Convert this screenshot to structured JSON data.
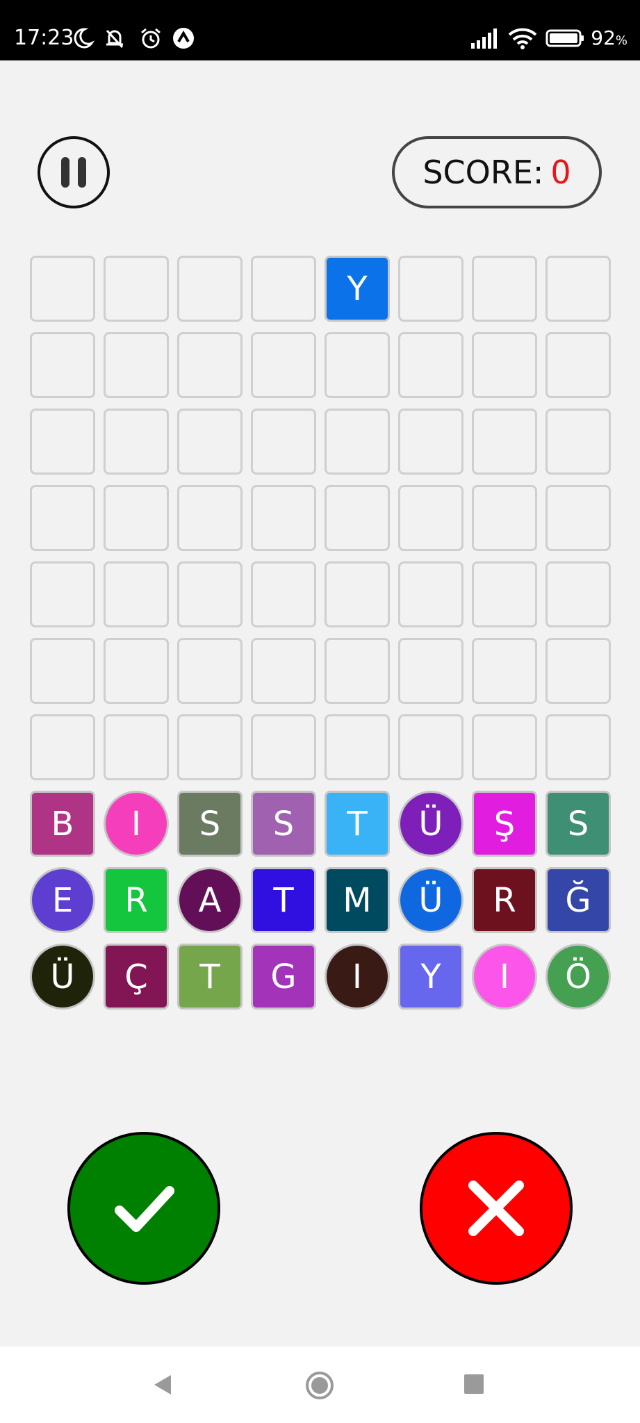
{
  "status_bar": {
    "time": "17:23",
    "battery": "92",
    "battery_unit": "%",
    "icons": [
      "moon-icon",
      "mute-icon",
      "alarm-icon",
      "app-notification-icon",
      "signal-icon",
      "wifi-icon",
      "battery-icon"
    ]
  },
  "header": {
    "pause_icon": "pause-icon",
    "score_label": "SCORE:",
    "score_value": "0",
    "score_color": "#e8161b"
  },
  "board": {
    "columns": 8,
    "rows": 10,
    "cells": [
      [
        null,
        null,
        null,
        null,
        {
          "letter": "Y",
          "color": "#0b72e9",
          "shape": "square"
        },
        null,
        null,
        null
      ],
      [
        null,
        null,
        null,
        null,
        null,
        null,
        null,
        null
      ],
      [
        null,
        null,
        null,
        null,
        null,
        null,
        null,
        null
      ],
      [
        null,
        null,
        null,
        null,
        null,
        null,
        null,
        null
      ],
      [
        null,
        null,
        null,
        null,
        null,
        null,
        null,
        null
      ],
      [
        null,
        null,
        null,
        null,
        null,
        null,
        null,
        null
      ],
      [
        null,
        null,
        null,
        null,
        null,
        null,
        null,
        null
      ],
      [
        {
          "letter": "B",
          "color": "#b03486",
          "shape": "square"
        },
        {
          "letter": "I",
          "color": "#f53ebc",
          "shape": "circle"
        },
        {
          "letter": "S",
          "color": "#6a7b62",
          "shape": "square"
        },
        {
          "letter": "S",
          "color": "#a061b0",
          "shape": "square"
        },
        {
          "letter": "T",
          "color": "#39b3f6",
          "shape": "square"
        },
        {
          "letter": "Ü",
          "color": "#7f1fb9",
          "shape": "circle"
        },
        {
          "letter": "Ş",
          "color": "#e11ee0",
          "shape": "square"
        },
        {
          "letter": "S",
          "color": "#3f8f74",
          "shape": "square"
        }
      ],
      [
        {
          "letter": "E",
          "color": "#5e3ed0",
          "shape": "circle"
        },
        {
          "letter": "R",
          "color": "#13c63d",
          "shape": "square"
        },
        {
          "letter": "A",
          "color": "#630f57",
          "shape": "circle"
        },
        {
          "letter": "T",
          "color": "#3010e0",
          "shape": "square"
        },
        {
          "letter": "M",
          "color": "#004a60",
          "shape": "square"
        },
        {
          "letter": "Ü",
          "color": "#0f68df",
          "shape": "circle"
        },
        {
          "letter": "R",
          "color": "#6d111f",
          "shape": "square"
        },
        {
          "letter": "Ğ",
          "color": "#3447a8",
          "shape": "square"
        }
      ],
      [
        {
          "letter": "Ü",
          "color": "#1f2309",
          "shape": "circle"
        },
        {
          "letter": "Ç",
          "color": "#821553",
          "shape": "square"
        },
        {
          "letter": "T",
          "color": "#76a64c",
          "shape": "square"
        },
        {
          "letter": "G",
          "color": "#a333b8",
          "shape": "square"
        },
        {
          "letter": "I",
          "color": "#3a1a15",
          "shape": "circle"
        },
        {
          "letter": "Y",
          "color": "#6767ee",
          "shape": "square"
        },
        {
          "letter": "I",
          "color": "#fb56e9",
          "shape": "circle"
        },
        {
          "letter": "Ö",
          "color": "#45a052",
          "shape": "circle"
        }
      ]
    ]
  },
  "actions": {
    "confirm_icon": "checkmark-icon",
    "confirm_color": "#008000",
    "cancel_icon": "close-icon",
    "cancel_color": "#ff0000"
  },
  "nav_bar": {
    "icons": [
      "back-icon",
      "home-icon",
      "recents-icon"
    ]
  }
}
